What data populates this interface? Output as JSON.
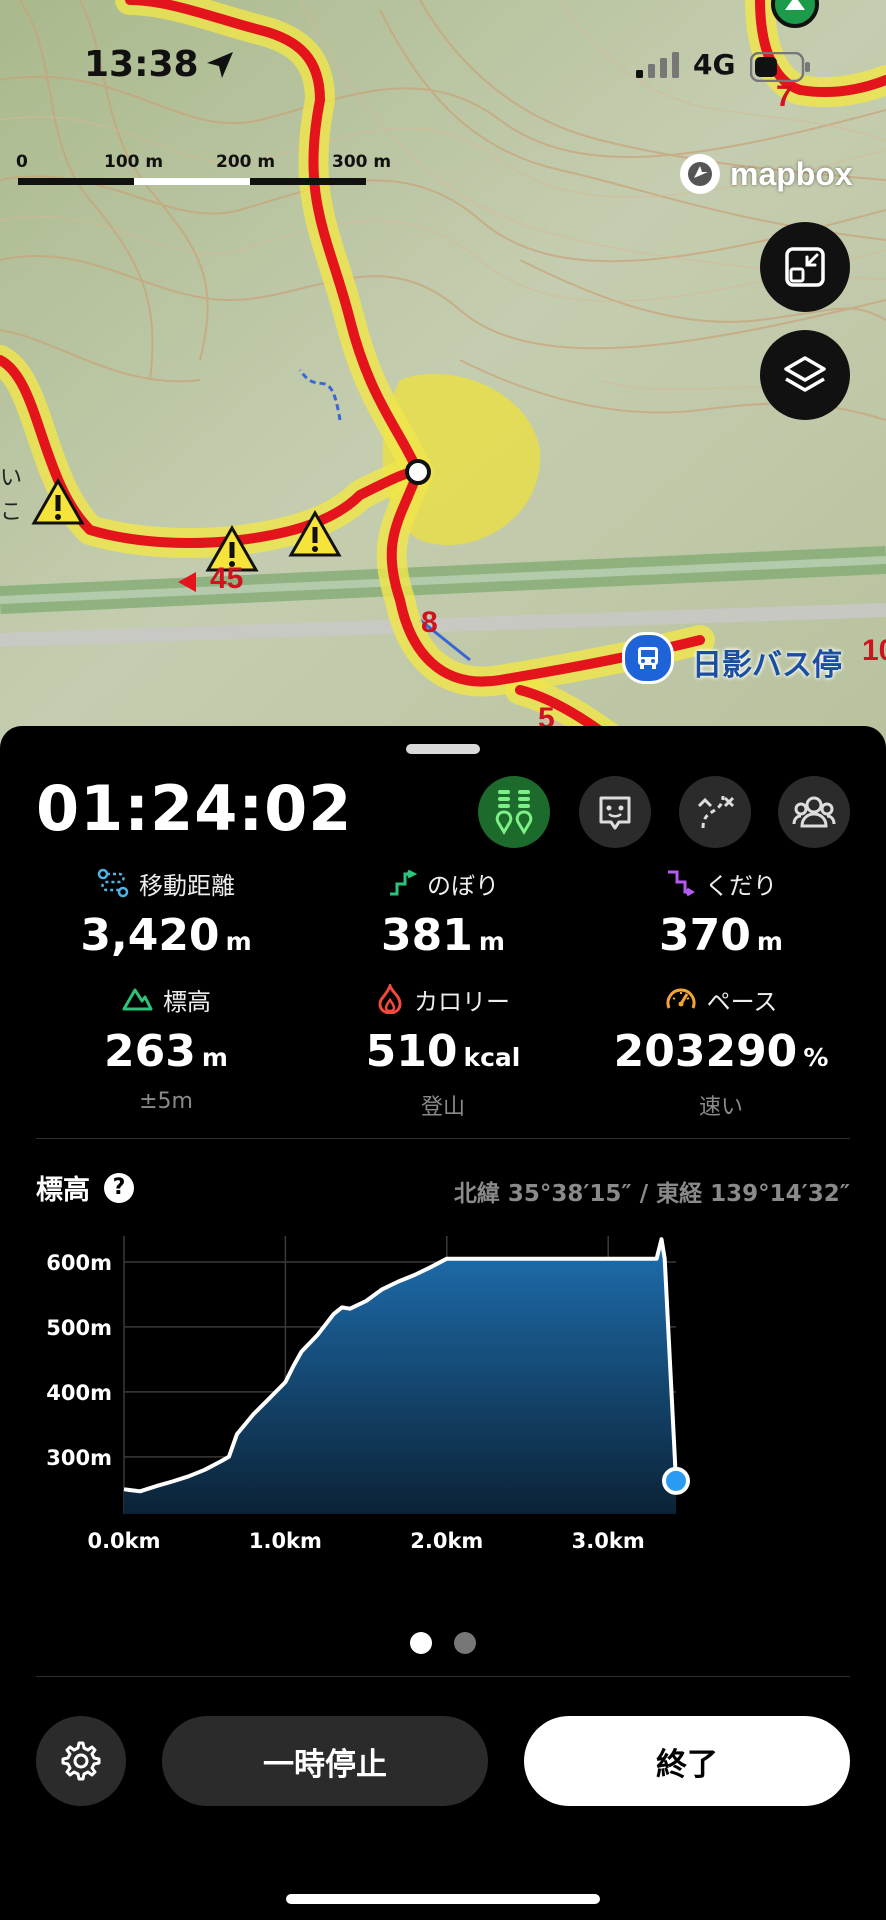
{
  "status_bar": {
    "time": "13:38",
    "network": "4G"
  },
  "map": {
    "scale_labels": [
      "0",
      "100 m",
      "200 m",
      "300 m"
    ],
    "attribution": "mapbox",
    "trail_numbers": [
      "7",
      "45",
      "8",
      "5",
      "10"
    ],
    "bus_stop": "日影バス停",
    "map_text": [
      "い",
      "こ"
    ]
  },
  "activity": {
    "elapsed": "01:24:02",
    "stats": [
      {
        "label": "移動距離",
        "value": "3,420",
        "unit": "m",
        "sub": ""
      },
      {
        "label": "のぼり",
        "value": "381",
        "unit": "m",
        "sub": ""
      },
      {
        "label": "くだり",
        "value": "370",
        "unit": "m",
        "sub": ""
      },
      {
        "label": "標高",
        "value": "263",
        "unit": "m",
        "sub": "±5m"
      },
      {
        "label": "カロリー",
        "value": "510",
        "unit": "kcal",
        "sub": "登山"
      },
      {
        "label": "ペース",
        "value": "203290",
        "unit": "%",
        "sub": "速い"
      }
    ]
  },
  "elevation": {
    "title": "標高",
    "coords": "北緯 35°38′15″ / 東経 139°14′32″"
  },
  "chart_data": {
    "type": "area",
    "xlabel": "",
    "ylabel": "",
    "x_ticks": [
      "0.0km",
      "1.0km",
      "2.0km",
      "3.0km"
    ],
    "y_ticks": [
      "300m",
      "400m",
      "500m",
      "600m"
    ],
    "xlim": [
      0,
      3.42
    ],
    "ylim": [
      212,
      640
    ],
    "grid": true,
    "x": [
      0.0,
      0.1,
      0.2,
      0.3,
      0.4,
      0.5,
      0.6,
      0.65,
      0.7,
      0.8,
      0.9,
      1.0,
      1.05,
      1.1,
      1.2,
      1.3,
      1.35,
      1.4,
      1.5,
      1.6,
      1.7,
      1.8,
      1.9,
      2.0,
      2.1,
      2.5,
      3.0,
      3.3,
      3.33,
      3.35,
      3.42
    ],
    "y": [
      250,
      247,
      255,
      262,
      270,
      280,
      293,
      300,
      335,
      365,
      390,
      415,
      440,
      462,
      488,
      520,
      530,
      528,
      540,
      558,
      570,
      580,
      592,
      605,
      605,
      605,
      605,
      605,
      635,
      605,
      263
    ],
    "colors": {
      "line": "#ffffff",
      "fill_top": "#1e6fb0",
      "fill_bottom": "#0b2236",
      "marker": "#2a9bf0"
    }
  },
  "pager": {
    "count": 2,
    "active": 0
  },
  "controls": {
    "pause": "一時停止",
    "end": "終了"
  }
}
